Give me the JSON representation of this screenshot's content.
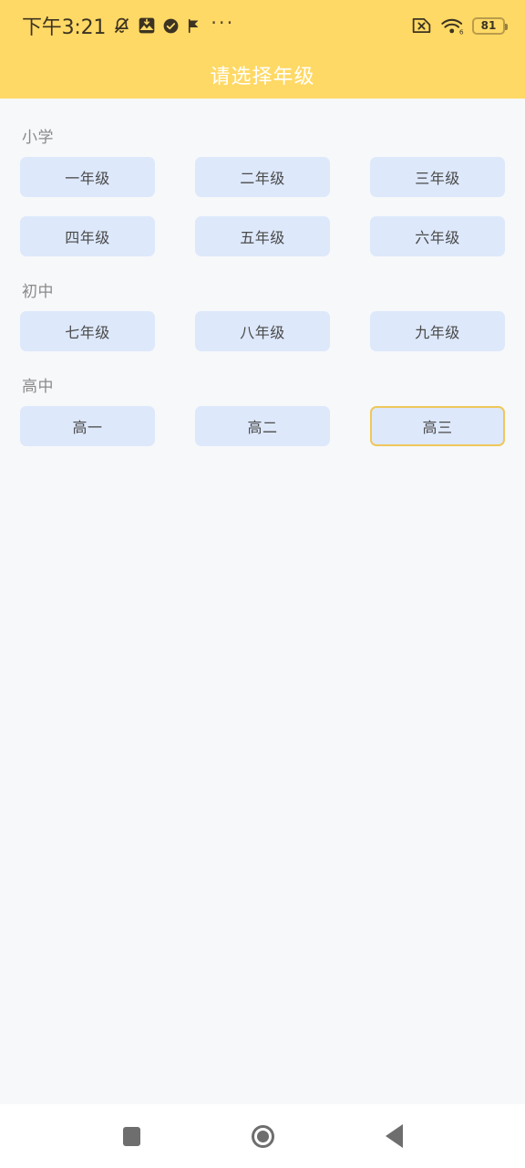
{
  "statusbar": {
    "clock": "下午3:21",
    "icons": [
      "bell-mute-icon",
      "image-download-icon",
      "check-circle-icon",
      "flag-icon"
    ],
    "overflow": "···",
    "right_icons": [
      "no-sim-icon",
      "wifi-6-icon"
    ],
    "battery_level": "81",
    "bar_color": "#ffd965"
  },
  "header": {
    "title": "请选择年级",
    "background": "#ffd965",
    "title_color": "#ffffff"
  },
  "colors": {
    "page_background": "#f7f8fa",
    "button_fill": "#dde8fb",
    "button_text": "#4a4a4a",
    "selected_border": "#efc75a",
    "section_label": "#8a8a8a",
    "nav_icon": "#6e6e6e"
  },
  "sections": [
    {
      "label": "小学",
      "grades": [
        {
          "label": "一年级",
          "selected": false
        },
        {
          "label": "二年级",
          "selected": false
        },
        {
          "label": "三年级",
          "selected": false
        },
        {
          "label": "四年级",
          "selected": false
        },
        {
          "label": "五年级",
          "selected": false
        },
        {
          "label": "六年级",
          "selected": false
        }
      ]
    },
    {
      "label": "初中",
      "grades": [
        {
          "label": "七年级",
          "selected": false
        },
        {
          "label": "八年级",
          "selected": false
        },
        {
          "label": "九年级",
          "selected": false
        }
      ]
    },
    {
      "label": "高中",
      "grades": [
        {
          "label": "高一",
          "selected": false
        },
        {
          "label": "高二",
          "selected": false
        },
        {
          "label": "高三",
          "selected": true
        }
      ]
    }
  ],
  "navbar": {
    "recents": "recents-square-icon",
    "home": "home-circle-icon",
    "back": "back-triangle-icon"
  }
}
